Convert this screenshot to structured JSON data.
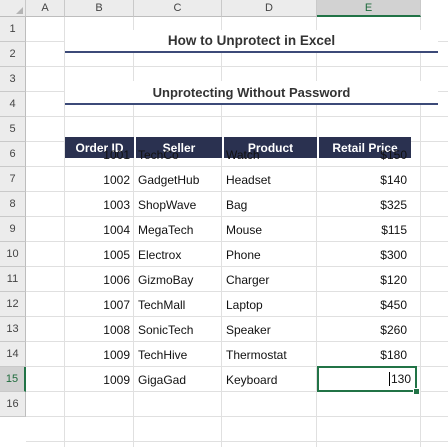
{
  "columns": [
    "A",
    "B",
    "C",
    "D",
    "E"
  ],
  "rows": [
    "1",
    "2",
    "3",
    "4",
    "5",
    "6",
    "7",
    "8",
    "9",
    "10",
    "11",
    "12",
    "13",
    "14",
    "15",
    "16"
  ],
  "selected_column": "E",
  "selected_row": "15",
  "title": "How to Unprotect in Excel",
  "subtitle": "Unprotecting Without Password",
  "table": {
    "headers": [
      "Order ID",
      "Seller",
      "Product",
      "Retail Price"
    ],
    "rows": [
      [
        "1001",
        "TechCo",
        "Watch",
        "$150"
      ],
      [
        "1002",
        "GadgetHub",
        "Headset",
        "$140"
      ],
      [
        "1003",
        "ShopWave",
        "Bag",
        "$325"
      ],
      [
        "1004",
        "MegaTech",
        "Mouse",
        "$115"
      ],
      [
        "1005",
        "Electrox",
        "Phone",
        "$300"
      ],
      [
        "1006",
        "GizmoBay",
        "Charger",
        "$120"
      ],
      [
        "1007",
        "TechMall",
        "Laptop",
        "$450"
      ],
      [
        "1008",
        "SonicTech",
        "Speaker",
        "$260"
      ],
      [
        "1009",
        "TechHive",
        "Thermostat",
        "$180"
      ],
      [
        "1009",
        "GigaGad",
        "Keyboard",
        "130"
      ]
    ]
  },
  "colors": {
    "header_fill": "#2a3150",
    "header_text": "#ffffff",
    "title_underline": "#3c4a78",
    "selection": "#217346"
  }
}
